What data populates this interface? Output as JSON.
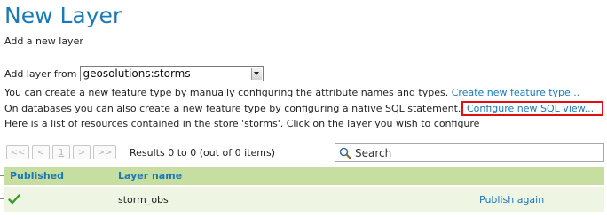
{
  "header": {
    "title": "New Layer",
    "subtitle": "Add a new layer"
  },
  "add_from": {
    "label": "Add layer from",
    "selected_store": "geosolutions:storms"
  },
  "info": {
    "manual_text": "You can create a new feature type by manually configuring the attribute names and types.",
    "manual_link": "Create new feature type...",
    "sql_text": "On databases you can also create a new feature type by configuring a native SQL statement.",
    "sql_link": "Configure new SQL view...",
    "resources_text": "Here is a list of resources contained in the store 'storms'. Click on the layer you wish to configure"
  },
  "pager": {
    "first": "<<",
    "prev": "<",
    "page": "1",
    "next": ">",
    "last": ">>",
    "results": "Results 0 to 0 (out of 0 items)"
  },
  "search": {
    "placeholder": "Search",
    "icon": "magnifier-icon"
  },
  "table": {
    "columns": [
      "Published",
      "Layer name"
    ],
    "rows": [
      {
        "published_icon": "checkmark-icon",
        "layer_name": "storm_obs",
        "action": "Publish again"
      }
    ]
  },
  "colors": {
    "title_blue": "#1a79b8",
    "link_blue": "#1a79b8",
    "header_green": "#c6dea0",
    "row_green": "#eef5e2",
    "highlight_red": "#e01010"
  }
}
